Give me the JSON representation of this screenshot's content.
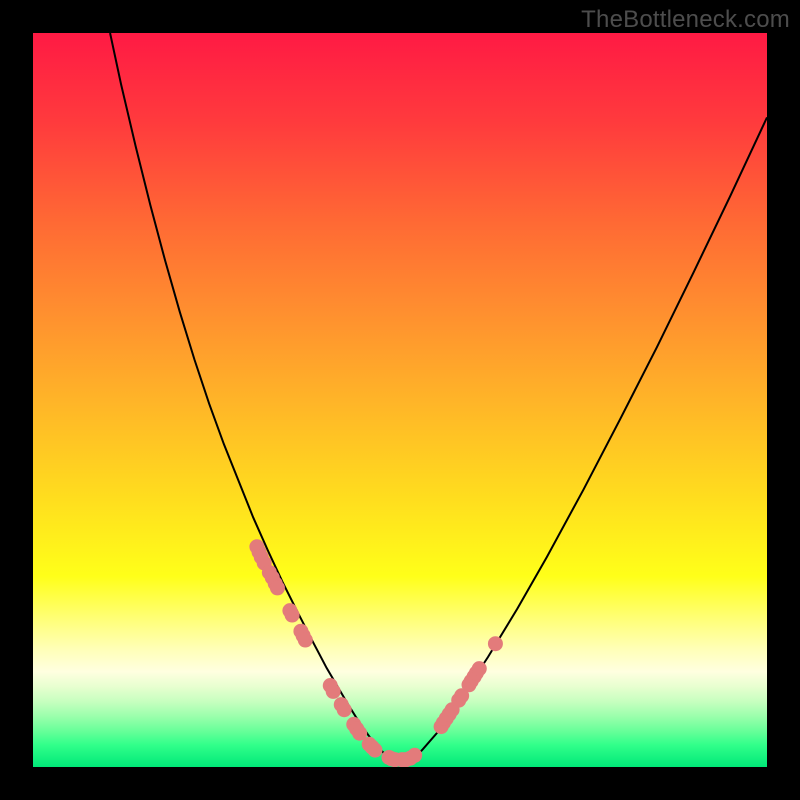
{
  "watermark": "TheBottleneck.com",
  "colors": {
    "curve": "#000000",
    "dots": "#e37b7b",
    "frame": "#000000"
  },
  "chart_data": {
    "type": "line",
    "title": "",
    "xlabel": "",
    "ylabel": "",
    "xlim": [
      0,
      100
    ],
    "ylim": [
      0,
      100
    ],
    "grid": false,
    "legend": false,
    "series": [
      {
        "name": "bottleneck-curve",
        "x": [
          10.5,
          12,
          14,
          16,
          18,
          20,
          22,
          24,
          26,
          28,
          30,
          32,
          34,
          36,
          38,
          39,
          40,
          41,
          42,
          43,
          44,
          45,
          46,
          47,
          48,
          49,
          50,
          51,
          52,
          53,
          55,
          58,
          62,
          66,
          70,
          75,
          80,
          85,
          90,
          95,
          100
        ],
        "y": [
          100,
          93,
          84.5,
          76.5,
          69,
          62,
          55.5,
          49.5,
          44,
          39,
          34,
          29.5,
          25.2,
          21.2,
          17.3,
          15.4,
          13.5,
          11.8,
          10.1,
          8.4,
          6.8,
          5.3,
          3.9,
          2.7,
          1.7,
          1.0,
          1.0,
          1.0,
          1.4,
          2.3,
          4.6,
          8.9,
          15.0,
          21.6,
          28.6,
          37.8,
          47.4,
          57.2,
          67.4,
          77.8,
          88.5
        ]
      }
    ],
    "dots": {
      "name": "highlight-dots",
      "x": [
        30.5,
        30.8,
        31.1,
        31.5,
        32.2,
        32.6,
        33.0,
        33.3,
        35.0,
        35.3,
        36.5,
        36.8,
        37.1,
        40.5,
        40.9,
        42.0,
        42.4,
        43.7,
        44.1,
        44.5,
        45.8,
        46.2,
        46.6,
        48.5,
        48.9,
        49.3,
        50.3,
        50.8,
        51.4,
        52.0,
        55.6,
        55.9,
        56.3,
        56.7,
        57.1,
        58.0,
        58.4,
        59.4,
        59.7,
        60.1,
        60.4,
        60.8,
        63.0
      ],
      "y": [
        30.0,
        29.3,
        28.6,
        27.8,
        26.5,
        25.8,
        25.0,
        24.4,
        21.3,
        20.7,
        18.5,
        17.9,
        17.3,
        11.1,
        10.3,
        8.5,
        7.8,
        5.8,
        5.2,
        4.6,
        3.1,
        2.7,
        2.3,
        1.3,
        1.1,
        1.0,
        1.0,
        1.0,
        1.2,
        1.6,
        5.5,
        6.0,
        6.6,
        7.2,
        7.8,
        9.1,
        9.7,
        11.2,
        11.7,
        12.3,
        12.8,
        13.4,
        16.8
      ],
      "r": 7.5
    }
  }
}
